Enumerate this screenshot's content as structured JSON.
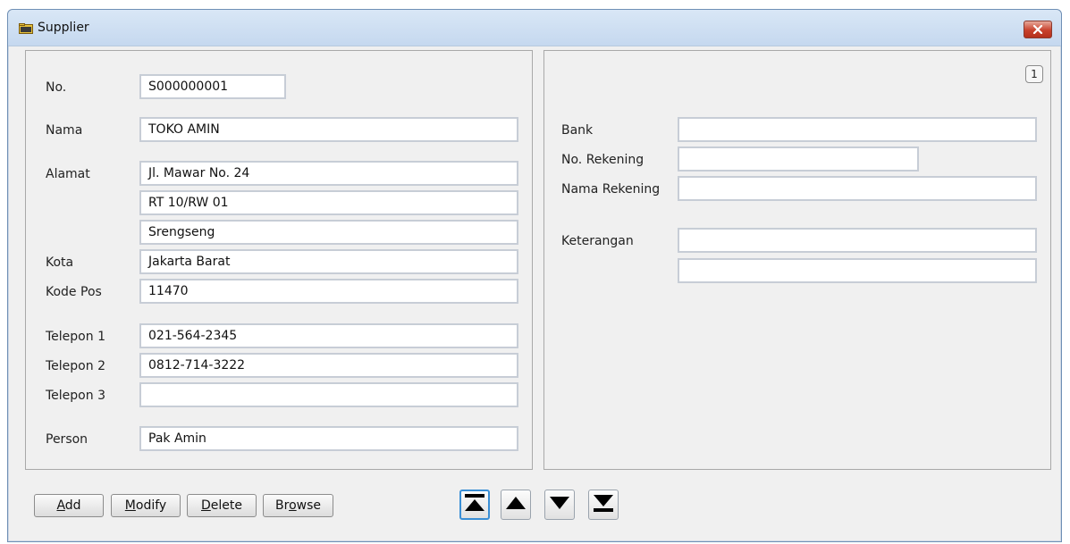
{
  "window": {
    "title": "Supplier",
    "icon": "folder-icon",
    "close_icon": "close-icon"
  },
  "page_indicator": "1",
  "left": {
    "no_label": "No.",
    "no_value": "S000000001",
    "nama_label": "Nama",
    "nama_value": "TOKO AMIN",
    "alamat_label": "Alamat",
    "alamat1": "Jl. Mawar No. 24",
    "alamat2": "RT 10/RW 01",
    "alamat3": "Srengseng",
    "kota_label": "Kota",
    "kota_value": "Jakarta Barat",
    "kodepos_label": "Kode Pos",
    "kodepos_value": "11470",
    "telp1_label": "Telepon 1",
    "telp1_value": "021-564-2345",
    "telp2_label": "Telepon 2",
    "telp2_value": "0812-714-3222",
    "telp3_label": "Telepon 3",
    "telp3_value": "",
    "person_label": "Person",
    "person_value": "Pak Amin"
  },
  "right": {
    "bank_label": "Bank",
    "bank_value": "",
    "norek_label": "No. Rekening",
    "norek_value": "",
    "namarek_label": "Nama Rekening",
    "namarek_value": "",
    "keterangan_label": "Keterangan",
    "keterangan1": "",
    "keterangan2": ""
  },
  "buttons": {
    "add": {
      "u": "A",
      "rest": "dd"
    },
    "modify": {
      "u": "M",
      "rest": "odify"
    },
    "delete": {
      "u": "D",
      "rest": "elete"
    },
    "browse": {
      "pre": "Br",
      "u": "o",
      "rest": "wse"
    }
  },
  "nav_icons": [
    "first-record-icon",
    "previous-record-icon",
    "next-record-icon",
    "last-record-icon"
  ]
}
